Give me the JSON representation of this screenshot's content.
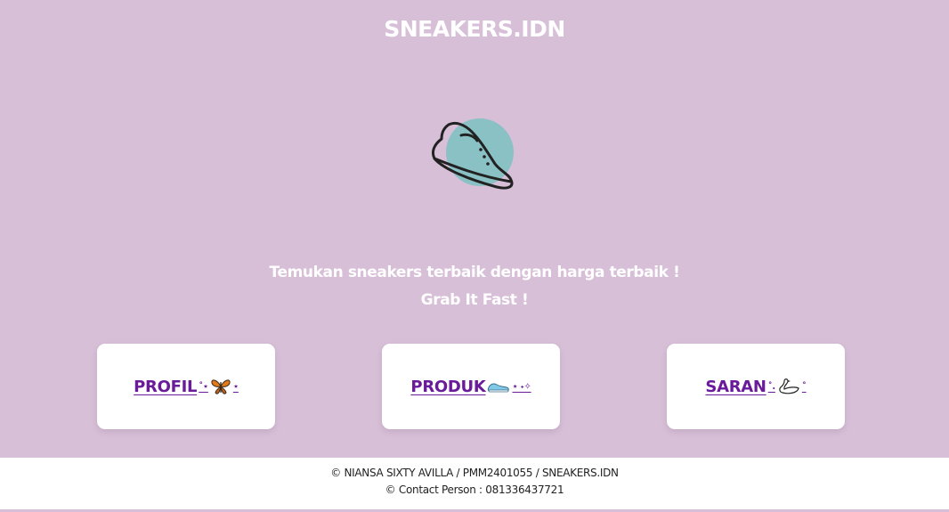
{
  "header": {
    "title": "SNEAKERS.IDN"
  },
  "logo": {
    "icon": "sneaker-icon",
    "blob_color": "#8ac1c4",
    "stroke_color": "#222222"
  },
  "hero": {
    "tagline": "Temukan sneakers terbaik dengan harga terbaik !",
    "subtagline": "Grab It Fast !"
  },
  "nav_cards": [
    {
      "label": "PROFIL",
      "deco_before": "˚⋆",
      "deco_after": "⋆",
      "icon": "butterfly-icon"
    },
    {
      "label": "PRODUK",
      "deco_after": "⋆ ˖✧",
      "icon": "sneaker-icon"
    },
    {
      "label": "SARAN",
      "deco_before": "˚.",
      "deco_after": "˚",
      "icon": "swan-icon"
    }
  ],
  "footer": {
    "credit": "© NIANSA SIXTY AVILLA / PMM2401055 / SNEAKERS.IDN",
    "contact": "© Contact Person : 081336437721"
  },
  "colors": {
    "background": "#d8bfd8",
    "card": "#ffffff",
    "link": "#6a1b9a",
    "footer": "#ffffff"
  }
}
